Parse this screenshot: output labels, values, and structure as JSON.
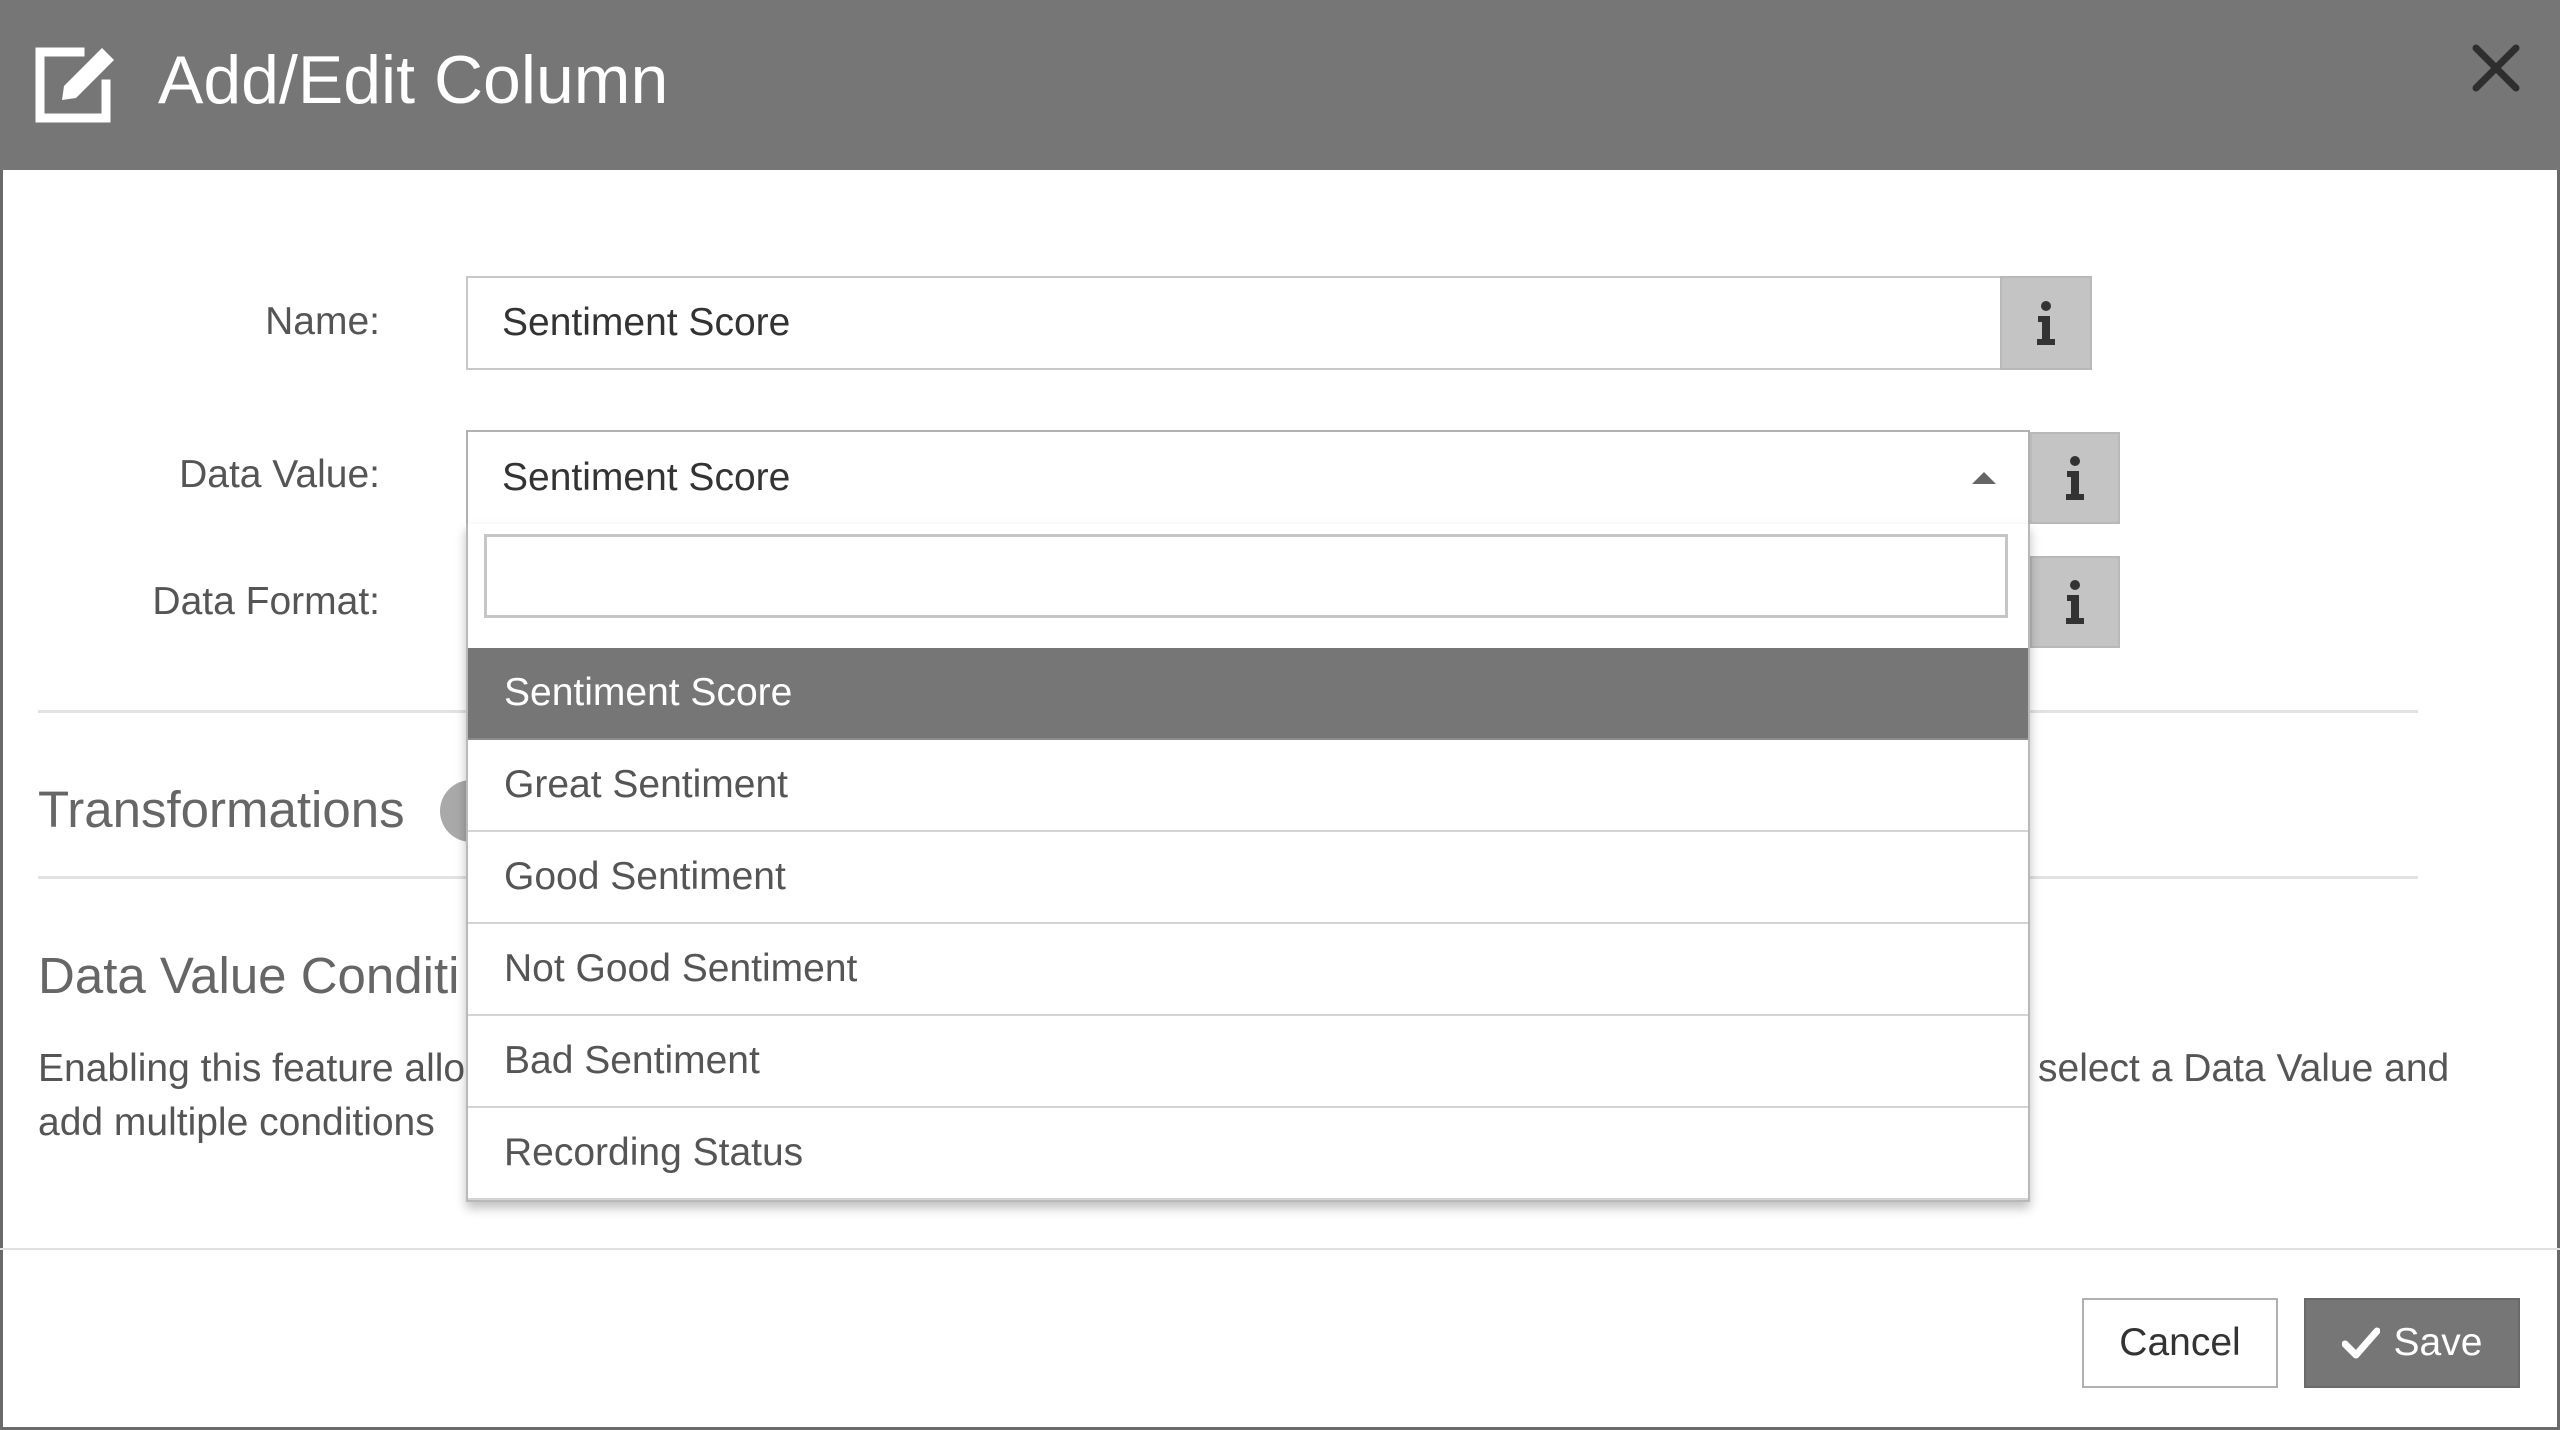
{
  "dialog": {
    "title": "Add/Edit Column",
    "header_icon": "edit-icon",
    "close_icon": "close-icon"
  },
  "form": {
    "name_label": "Name:",
    "name_value": "Sentiment Score",
    "data_value_label": "Data Value:",
    "data_value_selected": "Sentiment Score",
    "data_format_label": "Data Format:",
    "info_icon": "info-icon"
  },
  "dropdown": {
    "search_value": "",
    "options": [
      "Sentiment Score",
      "Great Sentiment",
      "Good Sentiment",
      "Not Good Sentiment",
      "Bad Sentiment",
      "Recording Status"
    ],
    "selected_index": 0
  },
  "sections": {
    "transformations_title": "Transformations",
    "conditions_title": "Data Value Conditi",
    "desc_left_line1": "Enabling this feature allo",
    "desc_left_line2": "add multiple conditions",
    "desc_right_line1": "select a Data Value and"
  },
  "footer": {
    "cancel_label": "Cancel",
    "save_label": "Save",
    "save_icon": "check-icon"
  },
  "colors": {
    "header_bg": "#767676",
    "selected_option_bg": "#767676",
    "info_button_bg": "#c4c4c4",
    "save_button_bg": "#767676"
  }
}
